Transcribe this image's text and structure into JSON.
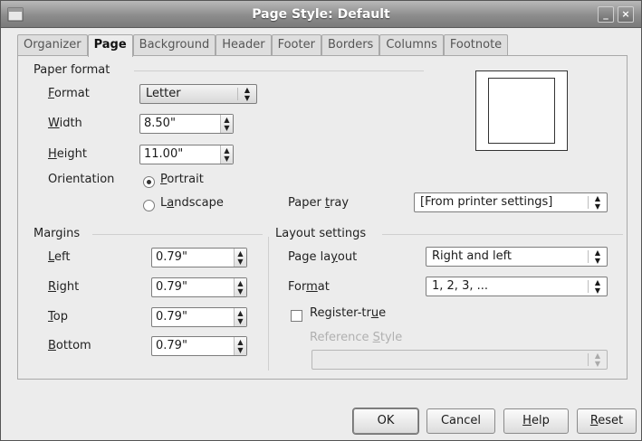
{
  "window": {
    "title": "Page Style: Default",
    "minimize_label": "_",
    "close_label": "×"
  },
  "tabs": [
    {
      "label": "Organizer"
    },
    {
      "label": "Page"
    },
    {
      "label": "Background"
    },
    {
      "label": "Header"
    },
    {
      "label": "Footer"
    },
    {
      "label": "Borders"
    },
    {
      "label": "Columns"
    },
    {
      "label": "Footnote"
    }
  ],
  "paper_format": {
    "title": "Paper format",
    "format": {
      "label_u": "F",
      "label_rest": "ormat",
      "value": "Letter"
    },
    "width": {
      "label_u": "W",
      "label_rest": "idth",
      "value": "8.50\""
    },
    "height": {
      "label_u": "H",
      "label_rest": "eight",
      "value": "11.00\""
    },
    "orientation": {
      "label": "Orientation",
      "portrait": {
        "label_u": "P",
        "label_rest": "ortrait",
        "checked": true
      },
      "landscape": {
        "label_pre": "L",
        "label_u": "a",
        "label_rest": "ndscape",
        "checked": false
      }
    },
    "paper_tray": {
      "label_pre": "Paper ",
      "label_u": "t",
      "label_rest": "ray",
      "value": "[From printer settings]"
    }
  },
  "margins": {
    "title": "Margins",
    "left": {
      "label_u": "L",
      "label_rest": "eft",
      "value": "0.79\""
    },
    "right": {
      "label_u": "R",
      "label_rest": "ight",
      "value": "0.79\""
    },
    "top": {
      "label_u": "T",
      "label_rest": "op",
      "value": "0.79\""
    },
    "bottom": {
      "label_u": "B",
      "label_rest": "ottom",
      "value": "0.79\""
    }
  },
  "layout_settings": {
    "title": "Layout settings",
    "page_layout": {
      "label_pre": "Page la",
      "label_u": "y",
      "label_rest": "out",
      "value": "Right and left"
    },
    "format": {
      "label_pre": "For",
      "label_u": "m",
      "label_rest": "at",
      "value": "1, 2, 3, ..."
    },
    "register_true": {
      "label_pre": "Register-tr",
      "label_u": "u",
      "label_rest": "e",
      "checked": false
    },
    "reference_style": {
      "label_pre": "Reference ",
      "label_u": "S",
      "label_rest": "tyle",
      "value": ""
    }
  },
  "buttons": {
    "ok": "OK",
    "cancel": "Cancel",
    "help": {
      "label_u": "H",
      "label_rest": "elp"
    },
    "reset": {
      "label_u": "R",
      "label_rest": "eset"
    }
  },
  "arrows": {
    "up": "▲",
    "down": "▼"
  }
}
